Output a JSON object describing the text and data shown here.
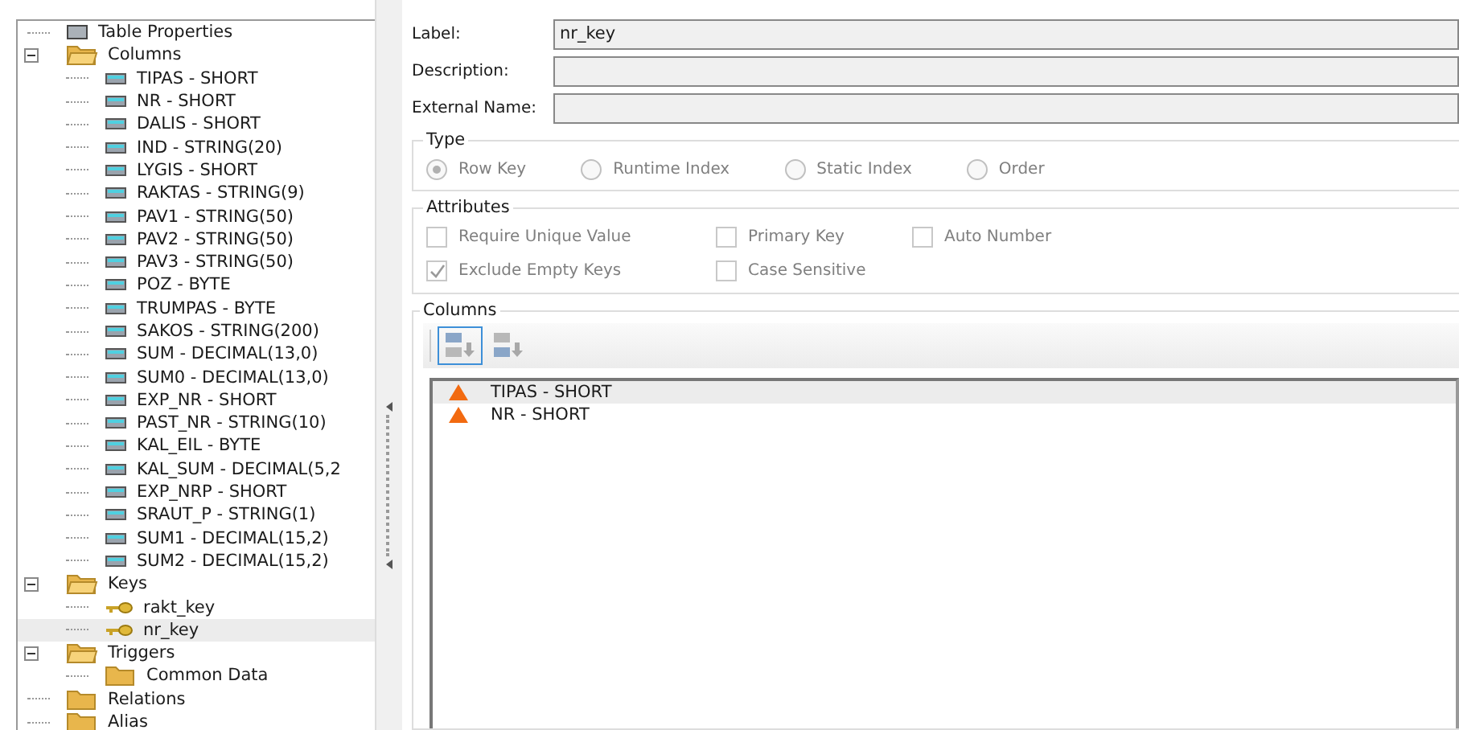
{
  "tree": [
    {
      "kind": "properties",
      "label": "Table Properties"
    },
    {
      "kind": "folder",
      "label": "Columns",
      "expanded": true,
      "children": [
        {
          "kind": "column",
          "label": "TIPAS - SHORT",
          "selected": false
        },
        {
          "kind": "column",
          "label": "NR - SHORT",
          "selected": false
        },
        {
          "kind": "column",
          "label": "DALIS - SHORT",
          "selected": false
        },
        {
          "kind": "column",
          "label": "IND - STRING(20)",
          "selected": false
        },
        {
          "kind": "column",
          "label": "LYGIS - SHORT",
          "selected": false
        },
        {
          "kind": "column",
          "label": "RAKTAS - STRING(9)",
          "selected": false
        },
        {
          "kind": "column",
          "label": "PAV1 - STRING(50)",
          "selected": false
        },
        {
          "kind": "column",
          "label": "PAV2 - STRING(50)",
          "selected": false
        },
        {
          "kind": "column",
          "label": "PAV3 - STRING(50)",
          "selected": false
        },
        {
          "kind": "column",
          "label": "POZ - BYTE",
          "selected": false
        },
        {
          "kind": "column",
          "label": "TRUMPAS - BYTE",
          "selected": false
        },
        {
          "kind": "column",
          "label": "SAKOS - STRING(200)",
          "selected": false
        },
        {
          "kind": "column",
          "label": "SUM - DECIMAL(13,0)",
          "selected": false
        },
        {
          "kind": "column",
          "label": "SUM0 - DECIMAL(13,0)",
          "selected": false
        },
        {
          "kind": "column",
          "label": "EXP_NR - SHORT",
          "selected": false
        },
        {
          "kind": "column",
          "label": "PAST_NR - STRING(10)",
          "selected": false
        },
        {
          "kind": "column",
          "label": "KAL_EIL - BYTE",
          "selected": false
        },
        {
          "kind": "column",
          "label": "KAL_SUM - DECIMAL(5,2",
          "selected": false
        },
        {
          "kind": "column",
          "label": "EXP_NRP - SHORT",
          "selected": false
        },
        {
          "kind": "column",
          "label": "SRAUT_P - STRING(1)",
          "selected": false
        },
        {
          "kind": "column",
          "label": "SUM1 - DECIMAL(15,2)",
          "selected": false
        },
        {
          "kind": "column",
          "label": "SUM2 - DECIMAL(15,2)",
          "selected": false
        }
      ]
    },
    {
      "kind": "folder",
      "label": "Keys",
      "expanded": true,
      "children": [
        {
          "kind": "key",
          "label": "rakt_key",
          "selected": false
        },
        {
          "kind": "key",
          "label": "nr_key",
          "selected": true
        }
      ]
    },
    {
      "kind": "folder",
      "label": "Triggers",
      "expanded": true,
      "children": [
        {
          "kind": "folder",
          "label": "Common Data"
        }
      ]
    },
    {
      "kind": "folder",
      "label": "Relations"
    },
    {
      "kind": "folder",
      "label": "Alias"
    }
  ],
  "fields": [
    {
      "label": "Label:",
      "value": "nr_key"
    },
    {
      "label": "Description:"
    },
    {
      "label": "External Name:"
    }
  ],
  "type_group": {
    "title": "Type",
    "disabled": true,
    "options": [
      {
        "label": "Row Key",
        "selected": true
      },
      {
        "label": "Runtime Index",
        "selected": false
      },
      {
        "label": "Static Index",
        "selected": false
      },
      {
        "label": "Order",
        "selected": false
      }
    ]
  },
  "attributes": {
    "title": "Attributes",
    "disabled": true,
    "options": [
      {
        "label": "Require Unique Value",
        "checked": false
      },
      {
        "label": "Primary Key",
        "checked": false
      },
      {
        "label": "Auto Number",
        "checked": false
      },
      {
        "label": "Exclude Empty Keys",
        "checked": true
      },
      {
        "label": "Case Sensitive",
        "checked": false
      }
    ]
  },
  "columns_group": {
    "title": "Columns",
    "toolbar": [
      {
        "kind": "ascending",
        "selected": true
      },
      {
        "kind": "descending",
        "selected": false
      }
    ],
    "rows": [
      {
        "label": "TIPAS - SHORT",
        "selected": true
      },
      {
        "label": "NR - SHORT",
        "selected": false
      }
    ]
  }
}
